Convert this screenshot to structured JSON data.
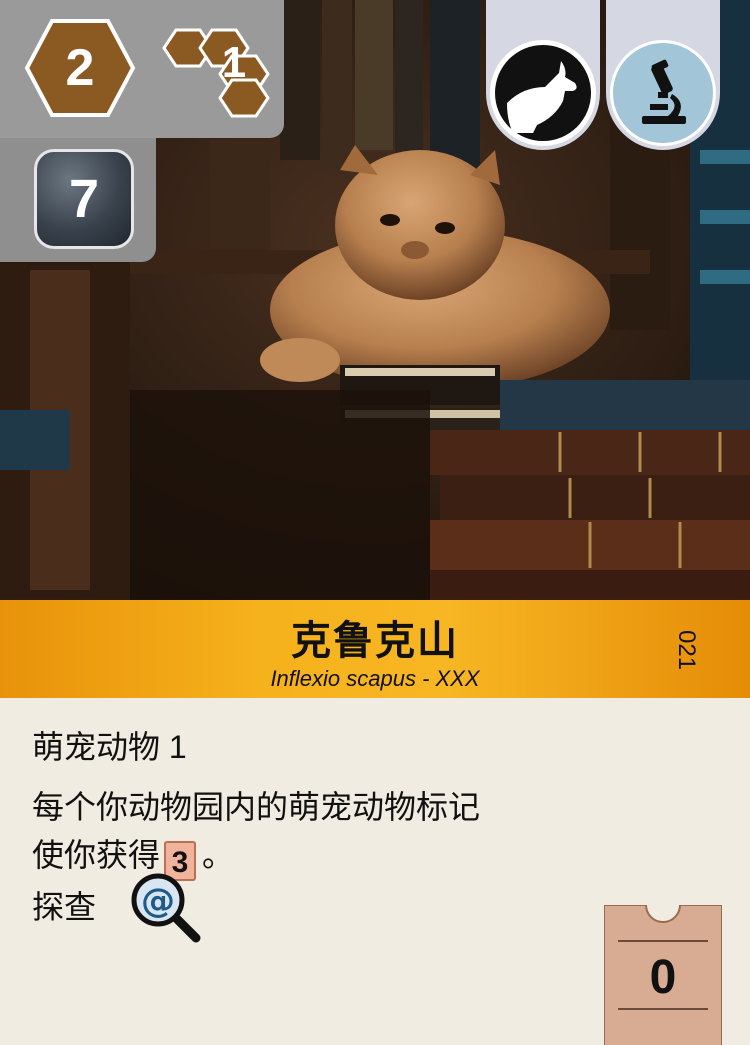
{
  "card": {
    "cost": "2",
    "enclosure_size": "1",
    "action_points": "7",
    "number": "021",
    "title": "克鲁克山",
    "subtitle": "Inflexio scapus - XXX",
    "ability": "萌宠动物 1",
    "effect_line1": "每个你动物园内的萌宠动物标记",
    "effect_line2_prefix": "使你获得",
    "effect_token": "3",
    "effect_line2_suffix": "。",
    "investigate_label": "探查",
    "investigate_symbol": "@",
    "appeal": "0"
  },
  "tags": [
    "goat-icon",
    "microscope-icon"
  ],
  "colors": {
    "banner": "#f2a414",
    "hex_cost": "#8b5a22",
    "action_badge": "#3a434d",
    "tag_bg": "#d5d8e2",
    "science_tag": "#a3c5d8",
    "ticket": "#d8ab93"
  }
}
